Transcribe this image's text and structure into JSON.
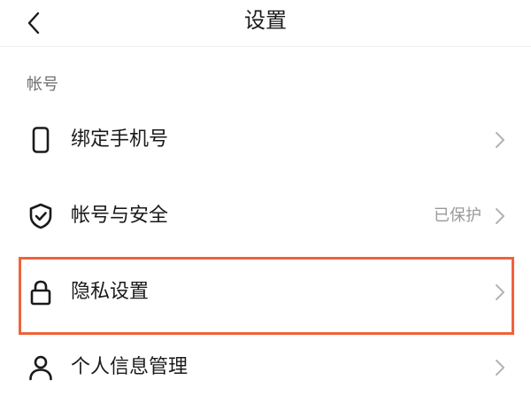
{
  "header": {
    "title": "设置",
    "back_icon": "chevron-left-icon"
  },
  "section": {
    "title": "帐号"
  },
  "items": [
    {
      "label": "绑定手机号",
      "value": "",
      "icon": "phone-icon",
      "chevron": "chevron-right-icon"
    },
    {
      "label": "帐号与安全",
      "value": "已保护",
      "icon": "shield-check-icon",
      "chevron": "chevron-right-icon"
    },
    {
      "label": "隐私设置",
      "value": "",
      "icon": "lock-icon",
      "chevron": "chevron-right-icon"
    },
    {
      "label": "个人信息管理",
      "value": "",
      "icon": "person-icon",
      "chevron": "chevron-right-icon"
    }
  ],
  "colors": {
    "highlight": "#f0623a",
    "text": "#1a1a1a",
    "muted": "#9a9a9a"
  }
}
